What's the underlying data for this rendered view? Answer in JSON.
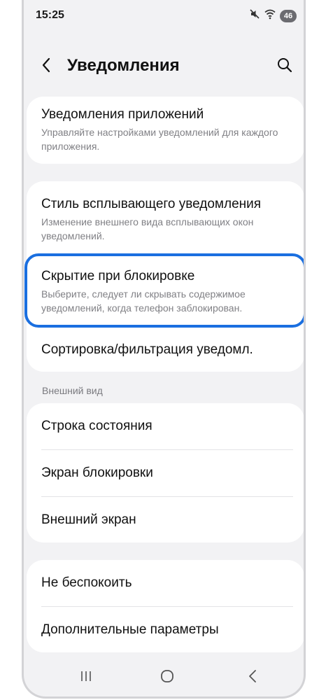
{
  "status_bar": {
    "time": "15:25",
    "battery_level": "46",
    "icons": [
      "mute-icon",
      "wifi-icon",
      "battery-icon"
    ]
  },
  "header": {
    "title": "Уведомления",
    "back_icon": "back-chevron-icon",
    "search_icon": "search-icon"
  },
  "app_notifications": {
    "title": "Уведомления приложений",
    "subtitle": "Управляйте настройками уведомлений для каждого приложения."
  },
  "group1": {
    "popup_style": {
      "title": "Стиль всплывающего уведомления",
      "subtitle": "Изменение внешнего вида всплывающих окон уведомлений."
    },
    "lock_hide": {
      "title": "Скрытие при блокировке",
      "subtitle": "Выберите, следует ли скрывать содержимое уведомлений, когда телефон заблокирован."
    },
    "sort_filter": {
      "title": "Сортировка/фильтрация уведомл."
    }
  },
  "appearance": {
    "section_label": "Внешний вид",
    "items": [
      {
        "title": "Строка состояния"
      },
      {
        "title": "Экран блокировки"
      },
      {
        "title": "Внешний экран"
      }
    ]
  },
  "group3": {
    "items": [
      {
        "title": "Не беспокоить"
      },
      {
        "title": "Дополнительные параметры"
      }
    ]
  },
  "nav_bar": {
    "icons": [
      "recent-apps-icon",
      "home-icon",
      "back-icon"
    ]
  },
  "colors": {
    "highlight": "#1a6fe0",
    "background": "#f2f2f4",
    "card": "#ffffff"
  }
}
